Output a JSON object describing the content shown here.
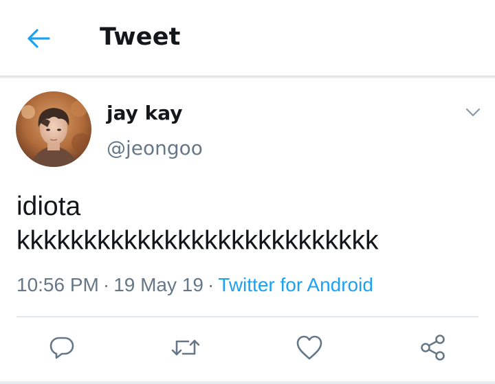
{
  "header": {
    "title": "Tweet",
    "back_icon": "arrow-left-icon",
    "accent_color": "#1da1f2"
  },
  "tweet": {
    "author_name": "jay kay",
    "author_handle": "@jeongoo",
    "text": "idiota\nkkkkkkkkkkkkkkkkkkkkkkkkkkk",
    "time": "10:56 PM",
    "date": "19 May 19",
    "separator": "·",
    "source": "Twitter for Android",
    "menu_icon": "chevron-down-icon"
  },
  "actions": [
    {
      "name": "reply",
      "icon": "reply-icon"
    },
    {
      "name": "retweet",
      "icon": "retweet-icon"
    },
    {
      "name": "like",
      "icon": "heart-icon"
    },
    {
      "name": "share",
      "icon": "share-icon"
    }
  ],
  "colors": {
    "primary_text": "#14171a",
    "secondary_text": "#657786",
    "link": "#1da1f2",
    "icon": "#657786",
    "divider": "#e1e8ed"
  }
}
